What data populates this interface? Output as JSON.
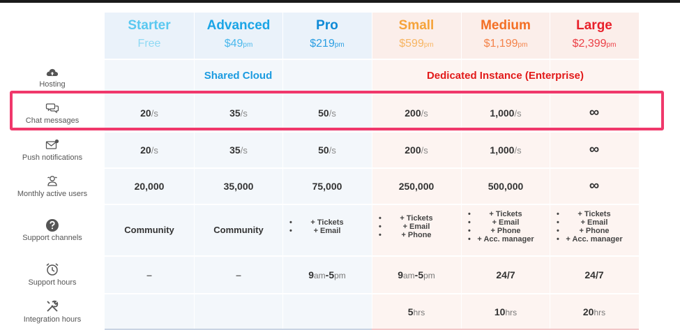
{
  "plans": [
    {
      "name": "Starter",
      "price": "Free",
      "unit": "",
      "color": "#5ac8f0",
      "price_color": "#8fd9f4"
    },
    {
      "name": "Advanced",
      "price": "$49",
      "unit": "pm",
      "color": "#1ba5e6",
      "price_color": "#4bb8ec"
    },
    {
      "name": "Pro",
      "price": "$219",
      "unit": "pm",
      "color": "#0c89d6",
      "price_color": "#2a9ee2"
    },
    {
      "name": "Small",
      "price": "$599",
      "unit": "pm",
      "color": "#f5a33a",
      "price_color": "#f7b562"
    },
    {
      "name": "Medium",
      "price": "$1,199",
      "unit": "pm",
      "color": "#f36f25",
      "price_color": "#f4834a"
    },
    {
      "name": "Large",
      "price": "$2,399",
      "unit": "pm",
      "color": "#e8212b",
      "price_color": "#eb3f46"
    }
  ],
  "groups": {
    "shared": {
      "label": "Shared Cloud",
      "color": "#1b9be0"
    },
    "dedicated": {
      "label": "Dedicated Instance (Enterprise)",
      "color": "#e21a1a"
    }
  },
  "rows": {
    "hosting": {
      "label": "Hosting",
      "icon": "cloud-upload-icon"
    },
    "chat": {
      "label": "Chat messages",
      "icon": "chat-bubbles-icon",
      "unit": "/s",
      "values": [
        "20",
        "35",
        "50",
        "200",
        "1,000",
        "∞"
      ]
    },
    "push": {
      "label": "Push notifications",
      "icon": "envelope-icon",
      "unit": "/s",
      "values": [
        "20",
        "35",
        "50",
        "200",
        "1,000",
        "∞"
      ]
    },
    "mau": {
      "label": "Monthly active users",
      "icon": "users-icon",
      "values": [
        "20,000",
        "35,000",
        "75,000",
        "250,000",
        "500,000",
        "∞"
      ]
    },
    "support": {
      "label": "Support channels",
      "icon": "question-circle-icon",
      "values": [
        "Community",
        "Community"
      ],
      "lists": {
        "pro": [
          "+ Tickets",
          "+ Email"
        ],
        "small": [
          "+ Tickets",
          "+ Email",
          "+ Phone"
        ],
        "medium": [
          "+ Tickets",
          "+ Email",
          "+ Phone",
          "+ Acc. manager"
        ],
        "large": [
          "+ Tickets",
          "+ Email",
          "+ Phone",
          "+ Acc. manager"
        ]
      }
    },
    "hours": {
      "label": "Support hours",
      "icon": "alarm-clock-icon",
      "dash": "–",
      "pro": {
        "a": "9",
        "au": "am",
        "sep": "-",
        "b": "5",
        "bu": "pm"
      },
      "small": {
        "a": "9",
        "au": "am",
        "sep": "-",
        "b": "5",
        "bu": "pm"
      },
      "medium": "24/7",
      "large": "24/7"
    },
    "integration": {
      "label": "Integration hours",
      "icon": "tools-icon",
      "small": {
        "v": "5",
        "u": "hrs"
      },
      "medium": {
        "v": "10",
        "u": "hrs"
      },
      "large": {
        "v": "20",
        "u": "hrs"
      }
    }
  },
  "bullet": "•"
}
